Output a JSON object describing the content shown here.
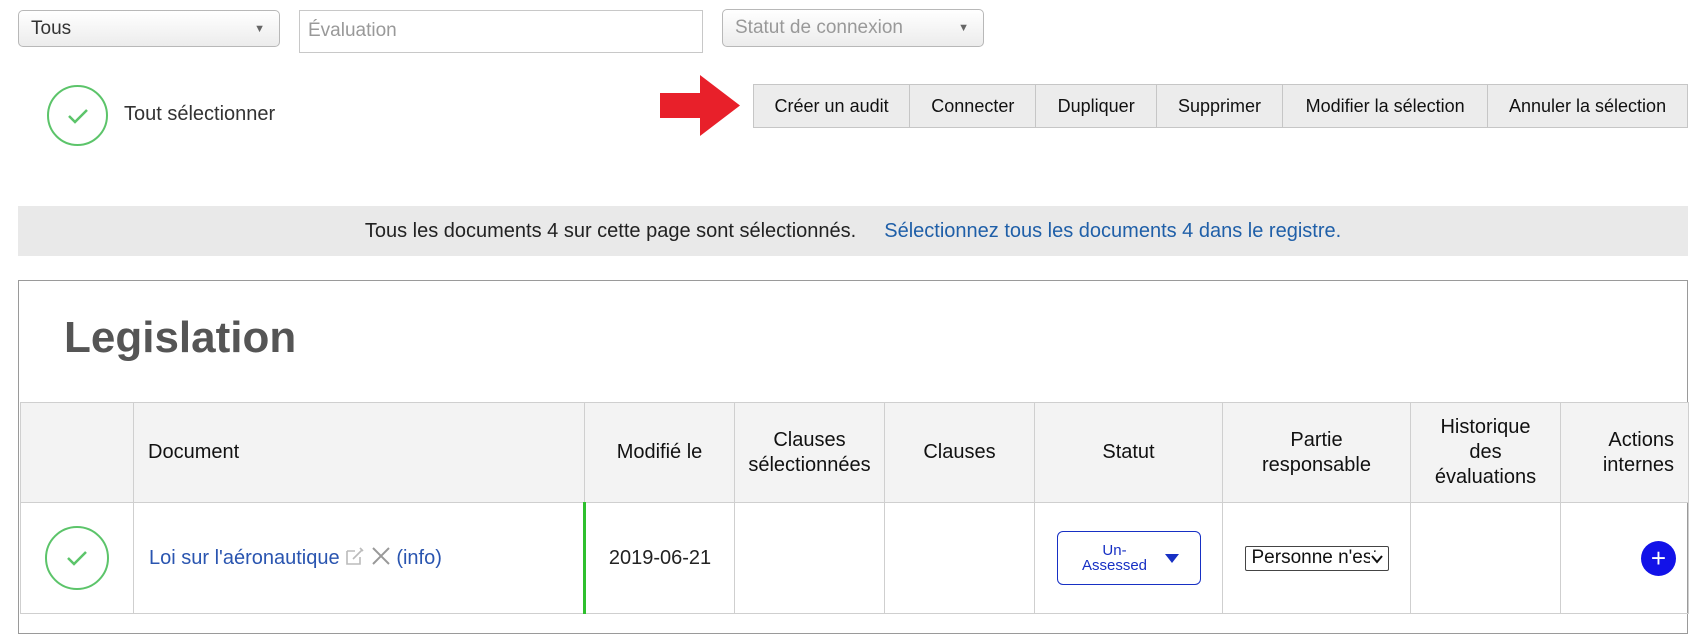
{
  "filters": {
    "scope_select": "Tous",
    "evaluation_placeholder": "Évaluation",
    "connection_status_placeholder": "Statut de connexion"
  },
  "select_all": {
    "label": "Tout sélectionner"
  },
  "toolbar": {
    "create_audit": "Créer un audit",
    "connect": "Connecter",
    "duplicate": "Dupliquer",
    "delete": "Supprimer",
    "edit_selection": "Modifier la sélection",
    "cancel_selection": "Annuler la sélection"
  },
  "banner": {
    "message": "Tous les documents 4 sur cette page sont sélectionnés.",
    "select_all_link": "Sélectionnez tous les documents 4 dans le registre."
  },
  "card": {
    "title": "Legislation"
  },
  "table": {
    "headers": {
      "document": "Document",
      "modified": "Modifié le",
      "selected_clauses": "Clauses sélectionnées",
      "clauses": "Clauses",
      "status": "Statut",
      "responsible": "Partie responsable",
      "history": "Historique des évaluations",
      "actions": "Actions internes"
    },
    "rows": [
      {
        "document": "Loi sur l'aéronautique",
        "info": "(info)",
        "modified": "2019-06-21",
        "selected_clauses": "",
        "clauses": "",
        "status": "Un-Assessed",
        "responsible": "Personne n'est",
        "history": ""
      }
    ]
  },
  "colors": {
    "accent_blue": "#1730c4",
    "link_blue": "#2a55b0",
    "check_green": "#5cc46a",
    "arrow_red": "#e8202a",
    "plus_blue": "#1212e8"
  }
}
